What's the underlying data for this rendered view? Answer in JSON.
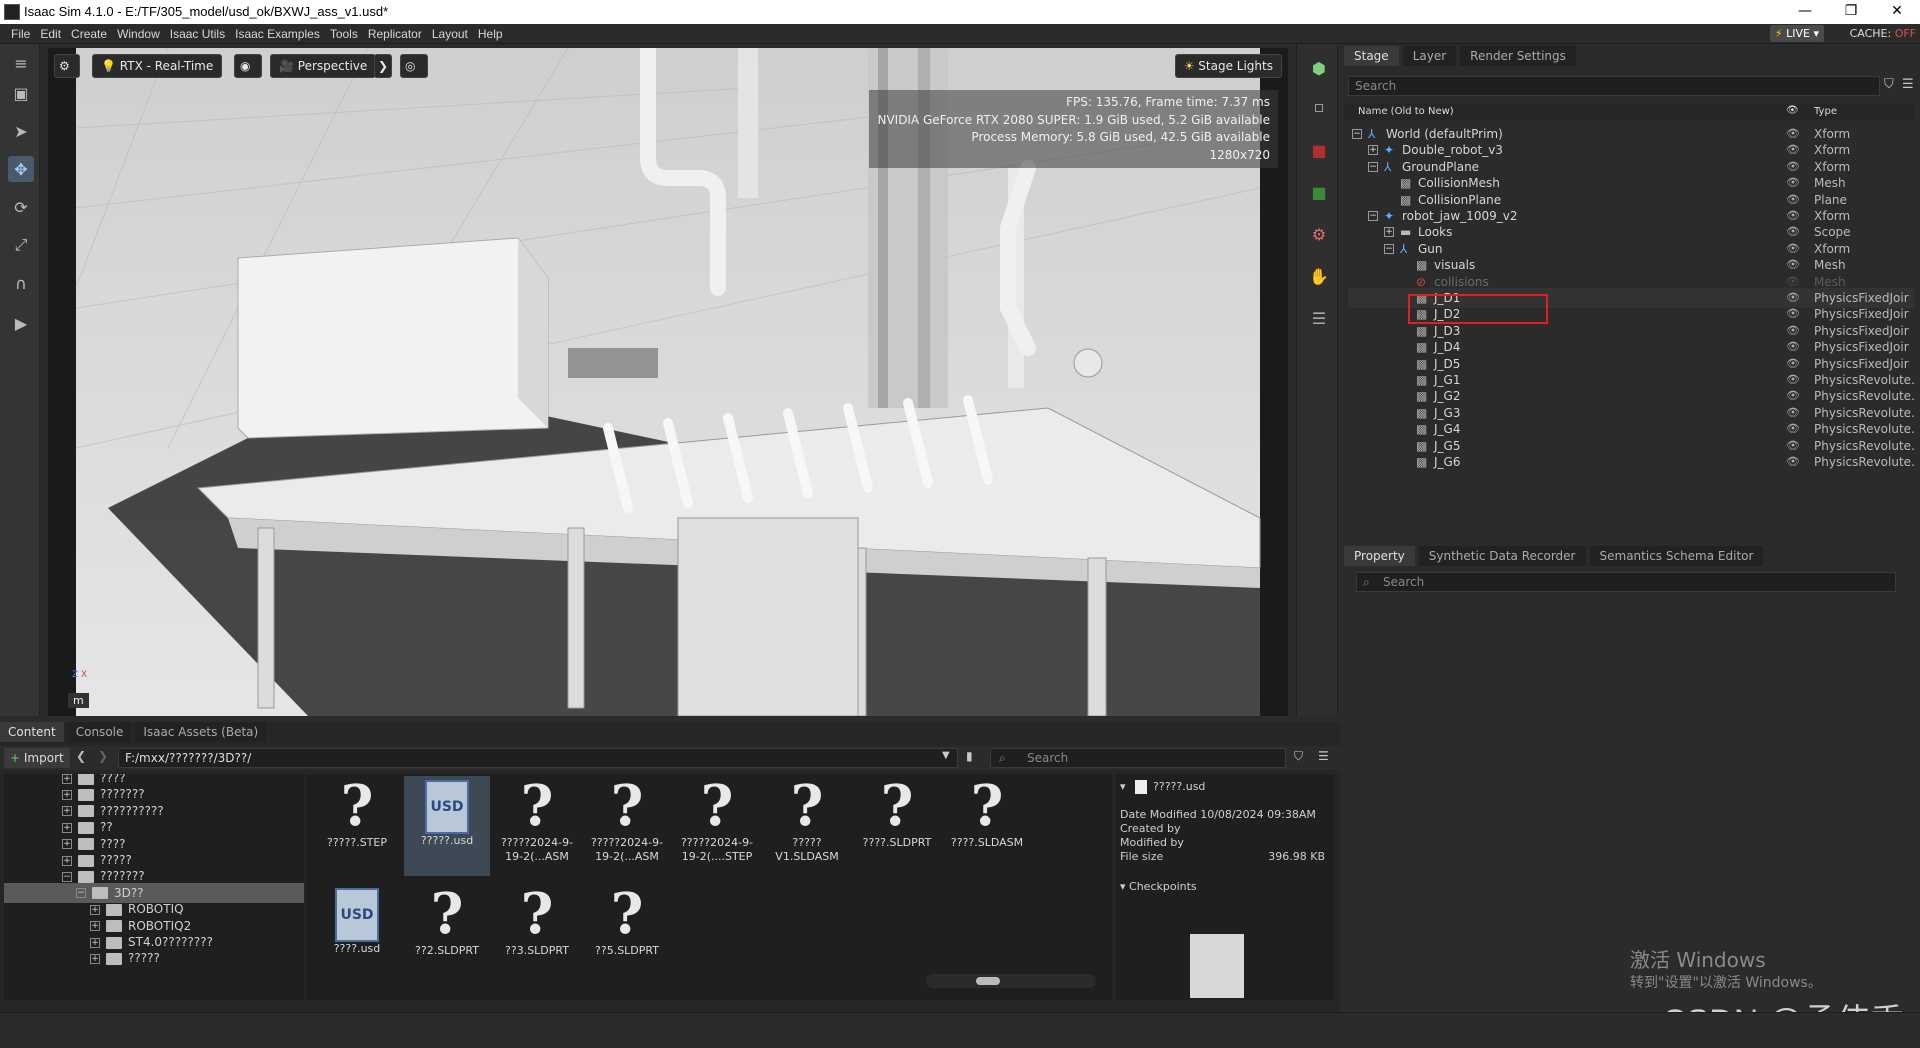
{
  "window": {
    "title": "Isaac Sim 4.1.0 - E:/TF/305_model/usd_ok/BXWJ_ass_v1.usd*",
    "controls": [
      "—",
      "❐",
      "✕"
    ]
  },
  "menu": {
    "items": [
      "File",
      "Edit",
      "Create",
      "Window",
      "Isaac Utils",
      "Isaac Examples",
      "Tools",
      "Replicator",
      "Layout",
      "Help"
    ],
    "live_label": "LIVE",
    "cache_label": "CACHE:",
    "cache_state": "OFF"
  },
  "viewport": {
    "render_mode": "RTX - Real-Time",
    "camera": "Perspective",
    "lights": "Stage Lights",
    "stats": [
      "FPS: 135.76, Frame time: 7.37 ms",
      "NVIDIA GeForce RTX 2080 SUPER: 1.9 GiB used, 5.2 GiB available",
      "Process Memory: 5.8 GiB used, 42.5 GiB available",
      "1280x720"
    ],
    "unit_label": "m",
    "axis_z": "Z",
    "axis_x": "X"
  },
  "stage": {
    "tabs": [
      "Stage",
      "Layer",
      "Render Settings"
    ],
    "search_placeholder": "Search",
    "col_name": "Name (Old to New)",
    "col_type": "Type",
    "rows": [
      {
        "name": "World (defaultPrim)",
        "type": "Xform",
        "icon": "xform-icon",
        "exp": "−"
      },
      {
        "name": "Double_robot_v3",
        "type": "Xform",
        "icon": "robot-icon",
        "exp": "+"
      },
      {
        "name": "GroundPlane",
        "type": "Xform",
        "icon": "xform-icon",
        "exp": "−"
      },
      {
        "name": "CollisionMesh",
        "type": "Mesh",
        "icon": "mesh-icon",
        "exp": ""
      },
      {
        "name": "CollisionPlane",
        "type": "Plane",
        "icon": "mesh-icon",
        "exp": ""
      },
      {
        "name": "robot_jaw_1009_v2",
        "type": "Xform",
        "icon": "robot-icon",
        "exp": "−"
      },
      {
        "name": "Looks",
        "type": "Scope",
        "icon": "folder-icon",
        "exp": "+"
      },
      {
        "name": "Gun",
        "type": "Xform",
        "icon": "xform-icon",
        "exp": "−"
      },
      {
        "name": "visuals",
        "type": "Mesh",
        "icon": "mesh-icon",
        "exp": ""
      },
      {
        "name": "collisions",
        "type": "Mesh",
        "icon": "disabled-icon",
        "exp": ""
      },
      {
        "name": "J_D1",
        "type": "PhysicsFixedJoir",
        "icon": "joint-icon",
        "exp": ""
      },
      {
        "name": "J_D2",
        "type": "PhysicsFixedJoir",
        "icon": "joint-icon",
        "exp": ""
      },
      {
        "name": "J_D3",
        "type": "PhysicsFixedJoir",
        "icon": "joint-icon",
        "exp": ""
      },
      {
        "name": "J_D4",
        "type": "PhysicsFixedJoir",
        "icon": "joint-icon",
        "exp": ""
      },
      {
        "name": "J_D5",
        "type": "PhysicsFixedJoir",
        "icon": "joint-icon",
        "exp": ""
      },
      {
        "name": "J_G1",
        "type": "PhysicsRevolute.",
        "icon": "joint-icon",
        "exp": ""
      },
      {
        "name": "J_G2",
        "type": "PhysicsRevolute.",
        "icon": "joint-icon",
        "exp": ""
      },
      {
        "name": "J_G3",
        "type": "PhysicsRevolute.",
        "icon": "joint-icon",
        "exp": ""
      },
      {
        "name": "J_G4",
        "type": "PhysicsRevolute.",
        "icon": "joint-icon",
        "exp": ""
      },
      {
        "name": "J_G5",
        "type": "PhysicsRevolute.",
        "icon": "joint-icon",
        "exp": ""
      },
      {
        "name": "J_G6",
        "type": "PhysicsRevolute.",
        "icon": "joint-icon",
        "exp": ""
      }
    ]
  },
  "property": {
    "tabs": [
      "Property",
      "Synthetic Data Recorder",
      "Semantics Schema Editor"
    ],
    "search_placeholder": "Search"
  },
  "content": {
    "tabs": [
      "Content",
      "Console",
      "Isaac Assets (Beta)"
    ],
    "import_label": "Import",
    "path": "F:/mxx/???????/3D??/",
    "search_placeholder": "Search",
    "folders": [
      {
        "name": "????",
        "exp": "+"
      },
      {
        "name": "???????",
        "exp": "+"
      },
      {
        "name": "??????????",
        "exp": "+"
      },
      {
        "name": "??",
        "exp": "+"
      },
      {
        "name": "????",
        "exp": "+"
      },
      {
        "name": "?????",
        "exp": "+"
      },
      {
        "name": "???????",
        "exp": "−"
      },
      {
        "name": "3D??",
        "exp": "−"
      },
      {
        "name": "ROBOTIQ",
        "exp": "+"
      },
      {
        "name": "ROBOTIQ2",
        "exp": "+"
      },
      {
        "name": "ST4.0????????",
        "exp": "+"
      },
      {
        "name": "?????",
        "exp": "+"
      }
    ],
    "files": [
      {
        "name": "?????.STEP",
        "kind": "unknown"
      },
      {
        "name": "?????.usd",
        "kind": "usd"
      },
      {
        "name": "?????2024-9-19-2(...ASM",
        "kind": "unknown"
      },
      {
        "name": "?????2024-9-19-2(...ASM",
        "kind": "unknown"
      },
      {
        "name": "?????2024-9-19-2(....STEP",
        "kind": "unknown"
      },
      {
        "name": "?????V1.SLDASM",
        "kind": "unknown"
      },
      {
        "name": "????.SLDPRT",
        "kind": "unknown"
      },
      {
        "name": "????.SLDASM",
        "kind": "unknown"
      },
      {
        "name": "????.usd",
        "kind": "usd"
      },
      {
        "name": "??2.SLDPRT",
        "kind": "unknown"
      },
      {
        "name": "??3.SLDPRT",
        "kind": "unknown"
      },
      {
        "name": "??5.SLDPRT",
        "kind": "unknown"
      }
    ],
    "details": {
      "filename": "?????.usd",
      "date_modified": "Date Modified 10/08/2024 09:38AM",
      "created_by": "Created by",
      "modified_by": "Modified by",
      "file_size_label": "File size",
      "file_size": "396.98 KB",
      "checkpoints": "Checkpoints"
    }
  },
  "overlay": {
    "activate_windows": "激活 Windows",
    "activate_hint": "转到\"设置\"以激活 Windows。",
    "csdn": "CSDN @孟伟秀"
  }
}
